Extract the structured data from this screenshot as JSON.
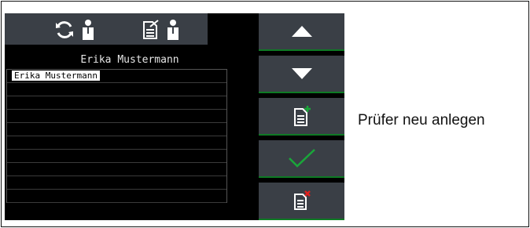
{
  "screen": {
    "topbar": {
      "icons": [
        "sync-user-icon",
        "edit-user-icon"
      ]
    },
    "title": "Erika Mustermann",
    "list": {
      "items": [
        "Erika Mustermann",
        "",
        "",
        "",
        "",
        "",
        "",
        "",
        "",
        ""
      ],
      "selected_index": 0
    },
    "side_buttons": [
      {
        "name": "scroll-up-button",
        "icon": "triangle-up-icon"
      },
      {
        "name": "scroll-down-button",
        "icon": "triangle-down-icon"
      },
      {
        "name": "new-tester-button",
        "icon": "document-add-icon"
      },
      {
        "name": "confirm-button",
        "icon": "checkmark-icon"
      },
      {
        "name": "delete-tester-button",
        "icon": "document-delete-icon"
      }
    ],
    "colors": {
      "background": "#000000",
      "panel": "#3a3f46",
      "accent_green": "#1aa63a",
      "delete_red": "#e0201e"
    }
  },
  "caption": "Prüfer neu anlegen"
}
